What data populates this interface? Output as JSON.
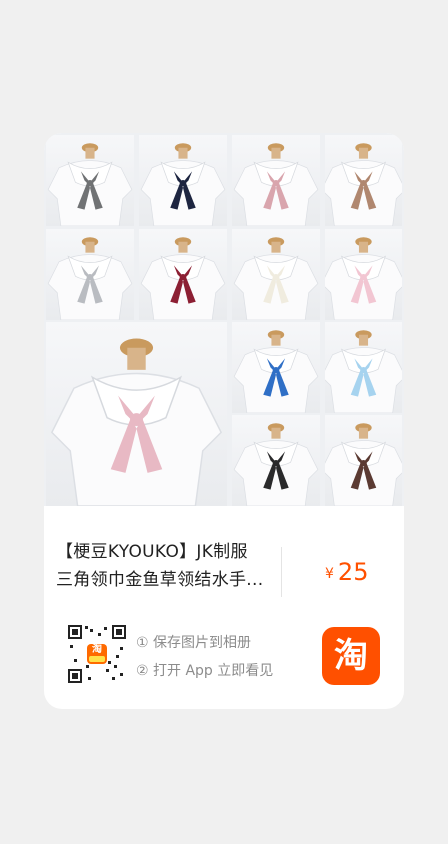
{
  "product": {
    "title_line1": "【梗豆KYOUKO】JK制服",
    "title_line2": "三角领巾金鱼草领结水手...",
    "currency": "¥",
    "price": "25"
  },
  "gallery": {
    "scarf_colors": [
      "#707274",
      "#1d2540",
      "#d9a5ad",
      "#b0876f",
      "#b9bcc1",
      "#8c1f33",
      "#f0ecdf",
      "#f2c6d2",
      "#e8b9c4",
      "#2f6fc6",
      "#a6d3ef",
      "#2a2a2b",
      "#5b3a32"
    ]
  },
  "share": {
    "qr_badge": "淘",
    "step1": "① 保存图片到相册",
    "step2": "② 打开 App 立即看见",
    "app_icon_glyph": "淘"
  }
}
